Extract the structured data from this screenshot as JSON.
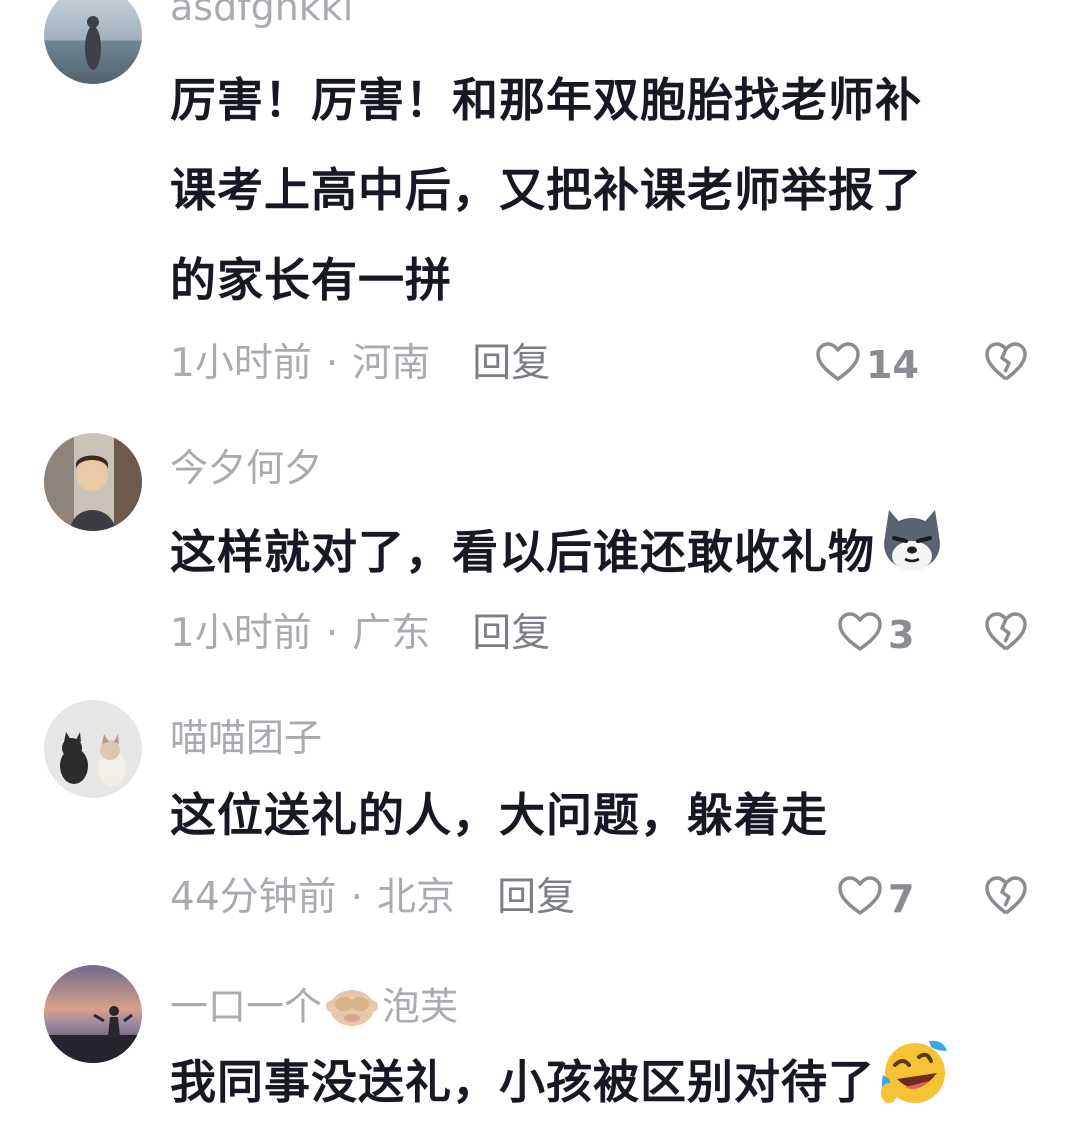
{
  "comments": [
    {
      "username": "asdfghkkl",
      "text_lines": [
        "厉害！厉害！和那年双胞胎找老师补",
        "课考上高中后，又把补课老师举报了",
        "的家长有一拼"
      ],
      "time": "1小时前",
      "location": "河南",
      "reply_label": "回复",
      "likes": "14",
      "avatar_icon": "woman-at-beach-photo"
    },
    {
      "username": "今夕何夕",
      "text_lines": [
        "这样就对了，看以后谁还敢收礼物"
      ],
      "trailing_emoji": "smug-dog-emoji",
      "time": "1小时前",
      "location": "广东",
      "reply_label": "回复",
      "likes": "3",
      "avatar_icon": "child-photo"
    },
    {
      "username": "喵喵团子",
      "text_lines": [
        "这位送礼的人，大问题，躲着走"
      ],
      "time": "44分钟前",
      "location": "北京",
      "reply_label": "回复",
      "likes": "7",
      "avatar_icon": "cats-photo"
    },
    {
      "username_parts": [
        "一口一个",
        "泡芙"
      ],
      "username_emoji": "see-no-evil-monkey-emoji",
      "text_lines": [
        "我同事没送礼，小孩被区别对待了"
      ],
      "trailing_emoji": "rolling-on-floor-laughing-emoji",
      "avatar_icon": "sunset-silhouette-photo"
    }
  ],
  "colors": {
    "text_primary": "#161823",
    "text_secondary": "#a9abb0",
    "background": "#ffffff"
  }
}
